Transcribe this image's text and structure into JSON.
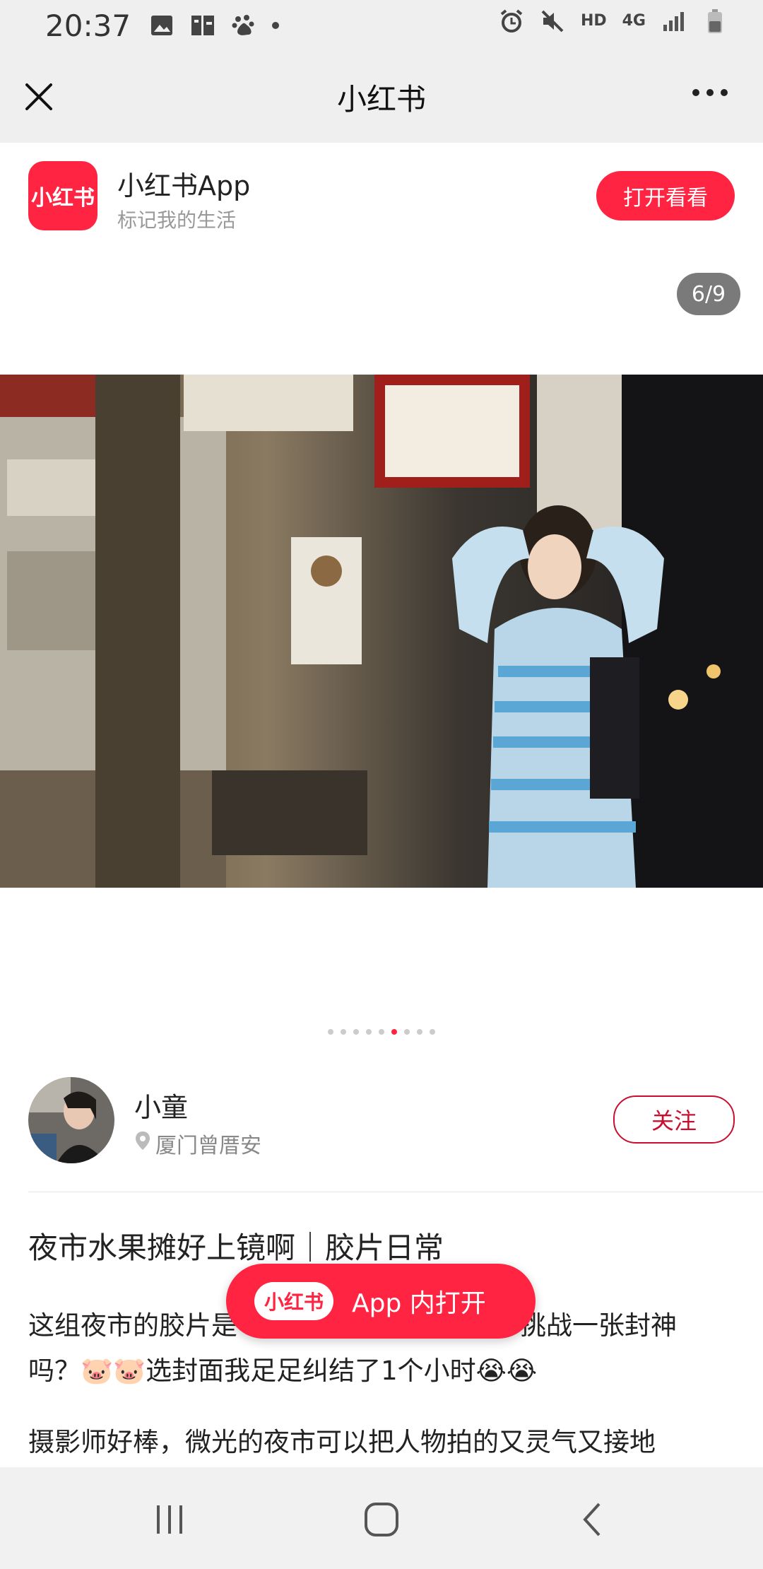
{
  "status_bar": {
    "time": "20:37",
    "network_hd": "HD",
    "network_4g": "4G"
  },
  "header": {
    "title": "小红书"
  },
  "app_banner": {
    "logo_text": "小红书",
    "name": "小红书App",
    "subtitle": "标记我的生活",
    "open_button": "打开看看"
  },
  "gallery": {
    "counter": "6/9",
    "total_images": 9,
    "current_index": 6
  },
  "author": {
    "name": "小童",
    "location": "厦门曾厝安",
    "follow_button": "关注"
  },
  "post": {
    "title": "夜市水果摊好上镜啊｜胶片日常",
    "body_line1": "这组夜市的胶片是",
    "body_line1_end": "挑战一张封神",
    "body_line2": "吗？🐷🐷选封面我足足纠结了1个小时😭😭",
    "body_line3": "摄影师好棒，微光的夜市可以把人物拍的又灵气又接地"
  },
  "float_button": {
    "logo_text": "小红书",
    "label": "App 内打开"
  },
  "colors": {
    "brand": "#ff2442",
    "follow": "#c8102e"
  }
}
